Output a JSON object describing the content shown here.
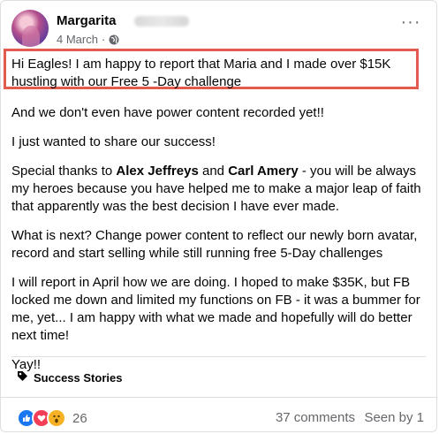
{
  "post": {
    "author": "Margarita",
    "date": "4 March",
    "dot": "·",
    "privacy_icon": "globe-icon",
    "more_label": "···",
    "paragraphs": {
      "p1": "Hi Eagles! I am happy to report that Maria and I made over $15K hustling with our Free 5 -Day challenge",
      "p2": "And we don't even have power content recorded yet!!",
      "p3": "I just wanted to share our success!",
      "p4_pre": "Special thanks to ",
      "p4_name1": "Alex Jeffreys",
      "p4_and": " and ",
      "p4_name2": "Carl Amery",
      "p4_post": " - you will be always my heroes because you have helped me to make a major leap of faith that apparently was the best decision I have ever made.",
      "p5": "What is next? Change power content to reflect our newly born avatar, record and start selling  while still running free 5-Day challenges",
      "p6": "I will report in April how we are doing. I hoped to make $35K, but FB locked me down and limited my functions on FB - it was a bummer for me, yet... I am happy with what we made and hopefully will do better next time!",
      "p7": "Yay!!"
    },
    "topic_tag": "Success Stories",
    "reactions": {
      "icons": [
        "like-icon",
        "love-icon",
        "wow-icon"
      ],
      "count": "26"
    },
    "comments": "37 comments",
    "seen": "Seen by 1",
    "colors": {
      "highlight_border": "#e25b4e",
      "like": "#1877f2",
      "love": "#f33e58",
      "wow": "#f7b125",
      "muted_text": "#65676b"
    }
  }
}
